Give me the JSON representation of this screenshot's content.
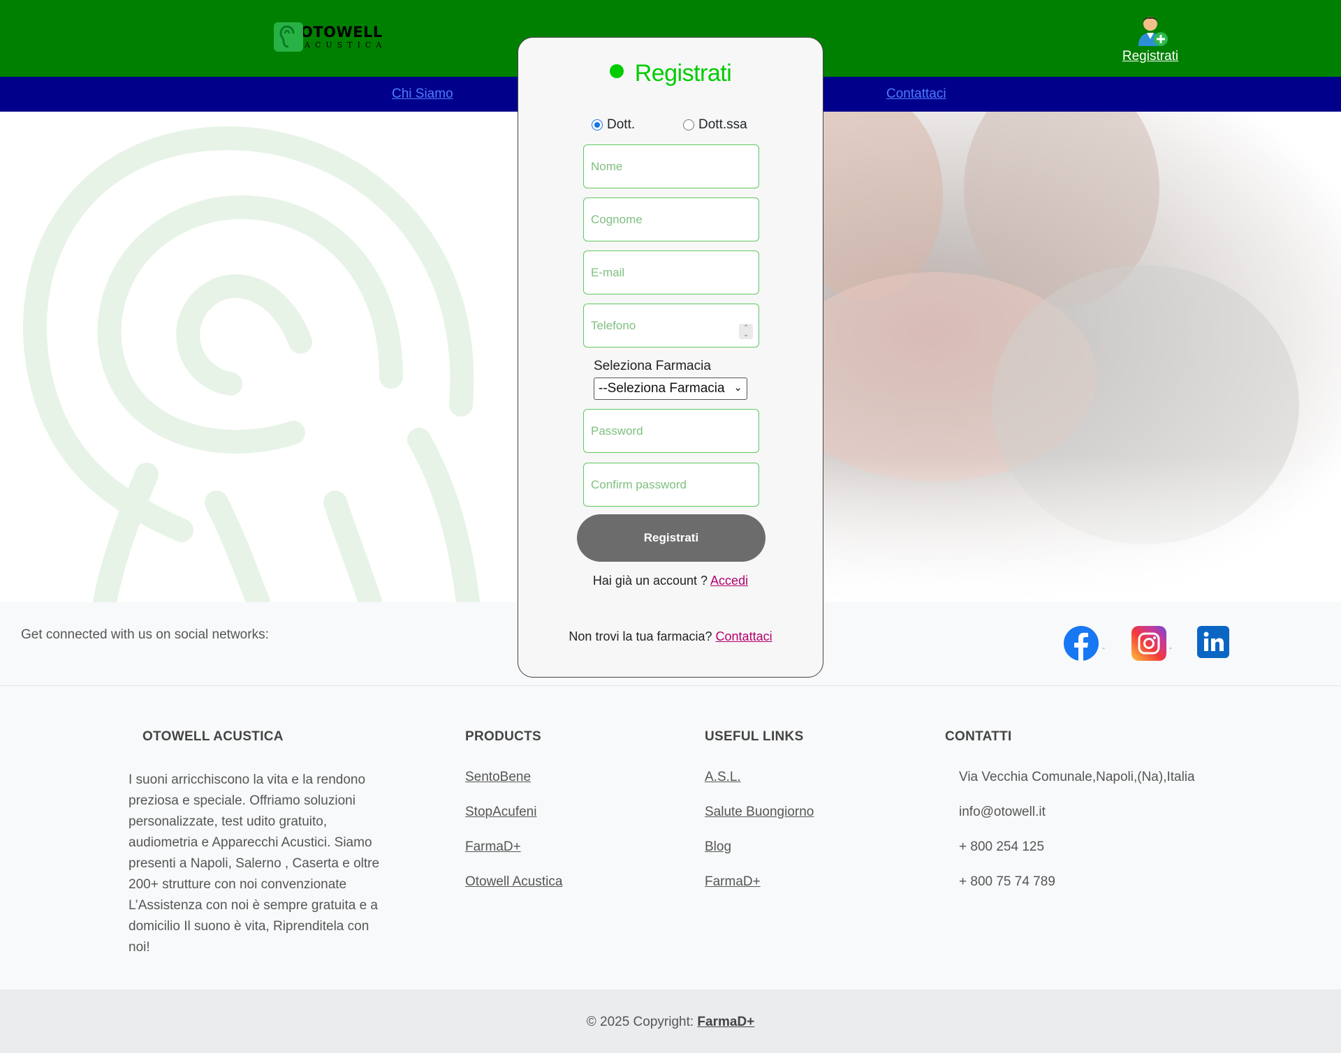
{
  "header": {
    "logo_line1": "OTOWELL",
    "logo_line2": "ACUSTICA",
    "register_link": "Registrati"
  },
  "nav": {
    "items": [
      "Chi Siamo",
      "Contattaci"
    ]
  },
  "modal": {
    "title": "Registrati",
    "radio_options": [
      {
        "label": "Dott.",
        "checked": true
      },
      {
        "label": "Dott.ssa",
        "checked": false
      }
    ],
    "fields": {
      "nome_placeholder": "Nome",
      "cognome_placeholder": "Cognome",
      "email_placeholder": "E-mail",
      "telefono_placeholder": "Telefono",
      "password_placeholder": "Password",
      "confirm_placeholder": "Confirm password"
    },
    "select_label": "Seleziona Farmacia",
    "select_value": "--Seleziona Farmacia",
    "submit_label": "Registrati",
    "login_prompt": "Hai già un account ?",
    "login_link": "Accedi",
    "pharmacy_prompt": "Non trovi la tua farmacia?",
    "pharmacy_link": "Contattaci"
  },
  "social": {
    "text": "Get connected with us on social networks:",
    "icons": [
      "facebook-icon",
      "instagram-icon",
      "linkedin-icon"
    ]
  },
  "footer": {
    "about": {
      "heading": "OTOWELL ACUSTICA",
      "lines": [
        "I suoni arricchiscono la vita e la rendono",
        "preziosa e speciale. Offriamo soluzioni",
        "personalizzate, test udito gratuito,",
        "audiometria e Apparecchi Acustici. Siamo",
        "presenti a Napoli, Salerno , Caserta e oltre",
        "200+ strutture con noi convenzionate",
        "L’Assistenza con noi è sempre gratuita e a",
        "domicilio Il suono è vita, Riprenditela con",
        "noi!"
      ]
    },
    "products": {
      "heading": "PRODUCTS",
      "links": [
        "SentoBene",
        "StopAcufeni",
        "FarmaD+",
        "Otowell Acustica"
      ]
    },
    "useful": {
      "heading": "USEFUL LINKS",
      "links": [
        "A.S.L.",
        "Salute Buongiorno",
        "Blog",
        "FarmaD+"
      ]
    },
    "contacts": {
      "heading": "CONTATTI",
      "items": [
        "Via Vecchia Comunale,Napoli,(Na),Italia",
        "info@otowell.it",
        "+ 800 254 125",
        "+ 800 75 74 789"
      ]
    },
    "copyright_prefix": "© 2025 Copyright:",
    "copyright_brand": "FarmaD+"
  },
  "colors": {
    "header_green": "#008000",
    "nav_blue": "#00008b",
    "title_green": "#00cc00",
    "link_magenta": "#b3006b"
  }
}
